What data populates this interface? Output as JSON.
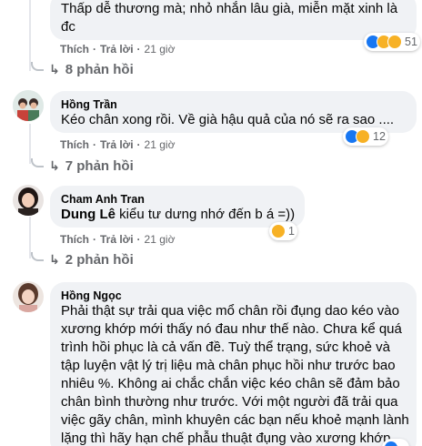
{
  "comments": [
    {
      "author": "",
      "text_line1": "Thấp dễ thương mà; nhỏ nhắn lâu già, miễn mặt xinh là",
      "text_line2": "đc",
      "like_label": "Thích",
      "reply_label": "Trả lời",
      "time": "21 giờ",
      "reaction_count": "51",
      "reactions": [
        "like-icon",
        "haha-icon",
        "sad-icon"
      ],
      "replies_label": "8 phản hồi"
    },
    {
      "author": "Hồng Trần",
      "text_line1": "Kéo chân xong rồi. Về già hậu quả của nó sẽ ra sao ....",
      "like_label": "Thích",
      "reply_label": "Trả lời",
      "time": "21 giờ",
      "reaction_count": "12",
      "reactions": [
        "like-icon",
        "haha-icon"
      ],
      "replies_label": "7 phản hồi"
    },
    {
      "author": "Cham Anh Tran",
      "mention": "Dung Lê",
      "text_line1": " kiểu tư dưng nhớ đến b á =))",
      "like_label": "Thích",
      "reply_label": "Trả lời",
      "time": "21 giờ",
      "reaction_count": "1",
      "reactions": [
        "haha-icon"
      ],
      "replies_label": "2 phản hồi"
    },
    {
      "author": "Hồng Ngọc",
      "lines": [
        "Phải thật sự trải qua việc mổ chân rồi đụng dao kéo vào",
        "xương khớp mới thấy nó đau như thế nào. Chưa kể quá",
        "trình hồi phục là cả vấn đề. Tuỳ thể trạng, sức khoẻ và",
        "tập luyện vật lý trị liệu mà chân phục hồi như trước bao",
        "nhiêu %. Không ai chắc chắn việc kéo chân sẽ đảm bảo",
        "chân bình thường như trước. Với một người đã trải qua",
        "việc gãy chân, mình khuyên các bạn nếu khoẻ mạnh lành",
        "lặng thì hãy hạn chế phẫu thuật đụng vào xương khớp."
      ]
    }
  ],
  "colors": {
    "bubble": "#f0f2f5",
    "muted": "#65676b",
    "like": "#1877f2",
    "emoji": "#f7b125"
  }
}
